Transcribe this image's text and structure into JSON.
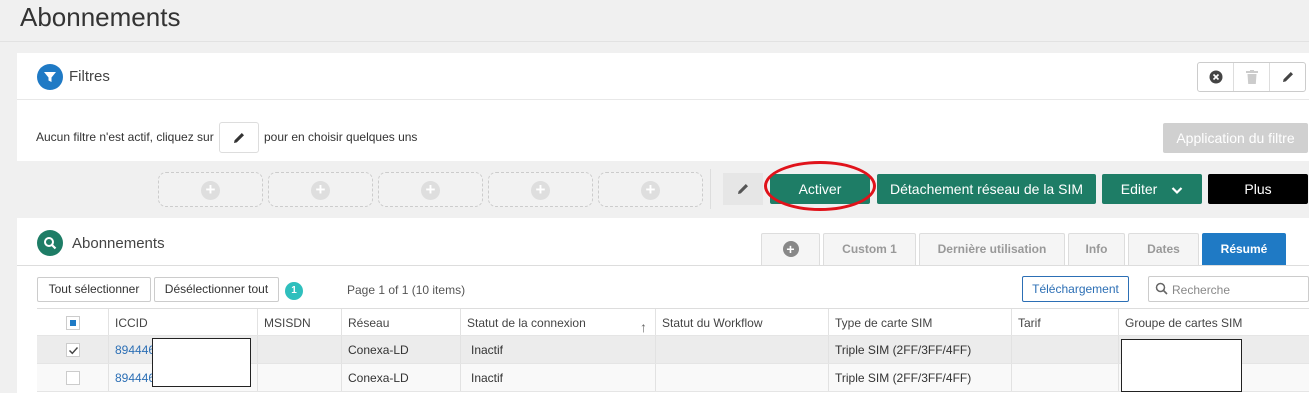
{
  "page": {
    "title": "Abonnements"
  },
  "filters": {
    "title": "Filtres",
    "message_before": "Aucun filtre n'est actif, cliquez sur",
    "message_after": "pour en choisir quelques uns",
    "apply_label": "Application du filtre",
    "header_actions": [
      "clear-filters",
      "delete-filter",
      "edit-filter"
    ]
  },
  "actions": {
    "filter_slots": 5,
    "activate": "Activer",
    "detach": "Détachement réseau de la SIM",
    "edit": "Editer",
    "more": "Plus",
    "colors": {
      "green": "#1e7d66",
      "highlight": "#e0121a"
    }
  },
  "subscriptions": {
    "title": "Abonnements",
    "tabs": [
      {
        "label": "",
        "icon": "plus-icon",
        "active": false
      },
      {
        "label": "Custom 1",
        "active": false
      },
      {
        "label": "Dernière utilisation",
        "active": false
      },
      {
        "label": "Info",
        "active": false
      },
      {
        "label": "Dates",
        "active": false
      },
      {
        "label": "Résumé",
        "active": true
      }
    ],
    "select_all": "Tout sélectionner",
    "deselect_all": "Désélectionner tout",
    "selected_count": "1",
    "page_info": "Page 1 of 1 (10 items)",
    "download": "Téléchargement",
    "search_placeholder": "Recherche",
    "columns": [
      "ICCID",
      "MSISDN",
      "Réseau",
      "Statut de la connexion",
      "Statut du Workflow",
      "Type de carte SIM",
      "Tarif",
      "Groupe de cartes SIM"
    ],
    "rows": [
      {
        "checked": true,
        "iccid": "894446",
        "msisdn": "",
        "network": "Conexa-LD",
        "connection_status": "Inactif",
        "workflow_status": "",
        "sim_type": "Triple SIM (2FF/3FF/4FF)",
        "tariff": "",
        "sim_group": ""
      },
      {
        "checked": false,
        "iccid": "894446",
        "msisdn": "",
        "network": "Conexa-LD",
        "connection_status": "Inactif",
        "workflow_status": "",
        "sim_type": "Triple SIM (2FF/3FF/4FF)",
        "tariff": "",
        "sim_group": ""
      }
    ]
  }
}
